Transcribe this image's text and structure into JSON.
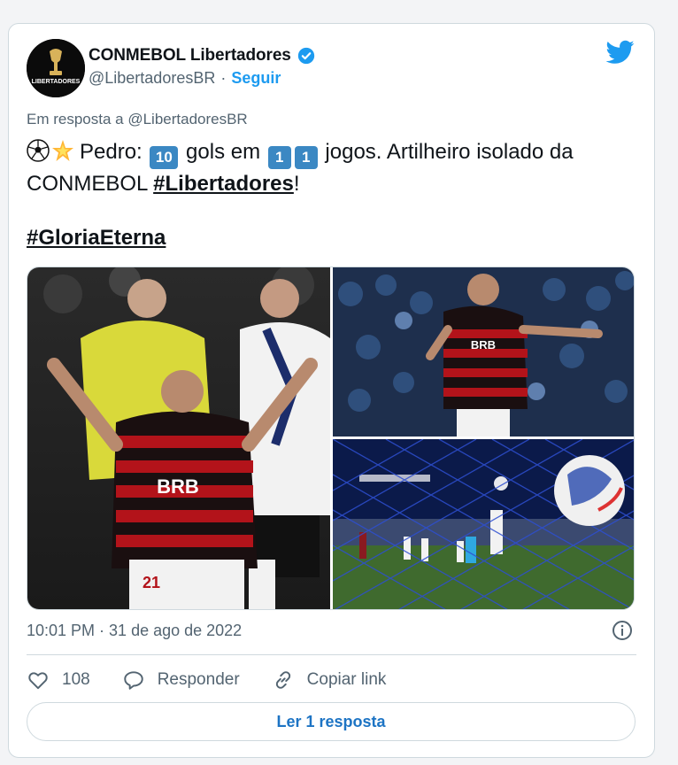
{
  "author": {
    "display_name": "CONMEBOL Libertadores",
    "handle": "@LibertadoresBR",
    "separator": "·",
    "follow_label": "Seguir",
    "avatar_text": "LIBERTADORES"
  },
  "reply_context": "Em resposta a @LibertadoresBR",
  "tweet": {
    "emoji_ball": "⚽",
    "emoji_star": "🌟",
    "text_a": "Pedro: ",
    "keycap_10": "10",
    "text_b": " gols em ",
    "keycap_1a": "1",
    "keycap_1b": "1",
    "text_c": " jogos. Artilheiro isolado da",
    "text_d": "CONMEBOL ",
    "hashtag_1": "#Libertadores",
    "text_e": "!",
    "hashtag_2": "#GloriaEterna"
  },
  "media": {
    "photo_1": {
      "alt": "Pedro kneeling and pointing to the sky in a red and black Flamengo shirt",
      "shirt_sponsor": "BRB",
      "shirt_number": "21"
    },
    "photo_2": {
      "alt": "Pedro celebrating in front of the crowd",
      "shirt_sponsor": "BRB"
    },
    "photo_3": {
      "alt": "Ball hitting the net, view from behind the goal"
    }
  },
  "timestamp": "10:01 PM · 31 de ago de 2022",
  "actions": {
    "likes_count": "108",
    "reply_label": "Responder",
    "copy_link_label": "Copiar link"
  },
  "read_replies_label": "Ler 1 resposta",
  "colors": {
    "accent": "#1d9bf0",
    "link_button": "#1d74c4",
    "border": "#cfd9de",
    "muted_text": "#536471",
    "keycap": "#3b88c3"
  },
  "icons": {
    "verified": "verified-badge-icon",
    "twitter": "twitter-bird-icon",
    "info": "info-icon",
    "like": "heart-icon",
    "reply": "speech-bubble-icon",
    "copy_link": "link-icon"
  }
}
